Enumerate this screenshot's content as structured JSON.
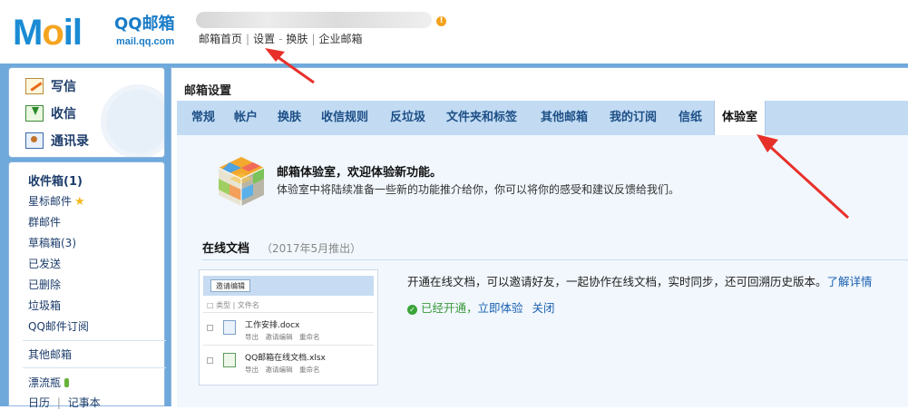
{
  "header": {
    "logo_text": "MOil",
    "logo_qq": "QQ邮箱",
    "logo_url": "mail.qq.com",
    "user_badge": "!",
    "links": [
      "邮箱首页",
      "设置",
      "换肤",
      "企业邮箱"
    ],
    "separators": [
      "|",
      "-",
      "|"
    ]
  },
  "compose": {
    "write": "写信",
    "receive": "收信",
    "contacts": "通讯录"
  },
  "folders": {
    "inbox": "收件箱(1)",
    "starred": "星标邮件",
    "group": "群邮件",
    "drafts": "草稿箱(3)",
    "sent": "已发送",
    "deleted": "已删除",
    "spam": "垃圾箱",
    "subscriptions": "QQ邮件订阅",
    "other_mailbox": "其他邮箱",
    "drift_bottle": "漂流瓶",
    "calendar": "日历",
    "calendar_sep": "|",
    "notes": "记事本"
  },
  "main": {
    "title": "邮箱设置",
    "tabs": [
      "常规",
      "帐户",
      "换肤",
      "收信规则",
      "反垃圾",
      "文件夹和标签",
      "其他邮箱",
      "我的订阅",
      "信纸",
      "体验室"
    ],
    "active_tab": "体验室"
  },
  "lab": {
    "intro_title": "邮箱体验室，欢迎体验新功能。",
    "intro_desc": "体验室中将陆续准备一些新的功能推介给你，你可以将你的感受和建议反馈给我们。",
    "section_title": "在线文档",
    "section_date": "（2017年5月推出）",
    "description": "开通在线文档，可以邀请好友，一起协作在线文档，实时同步，还可回溯历史版本。",
    "learn_more": "了解详情",
    "status": "已经开通，",
    "try_now": "立即体验",
    "close": "关闭",
    "preview": {
      "button": "邀请编辑",
      "col_type": "类型",
      "col_sep": "|",
      "col_name": "文件名",
      "files": [
        {
          "name": "工作安排.docx",
          "actions": "导出　邀请编辑　重命名"
        },
        {
          "name": "QQ邮箱在线文档.xlsx",
          "actions": "导出　邀请编辑　重命名"
        }
      ]
    }
  },
  "colors": {
    "brand_blue": "#1a8bd4",
    "frame_blue": "#6fa9dc",
    "tab_bar": "#c2dbf3",
    "annotation_red": "#e8302a"
  }
}
